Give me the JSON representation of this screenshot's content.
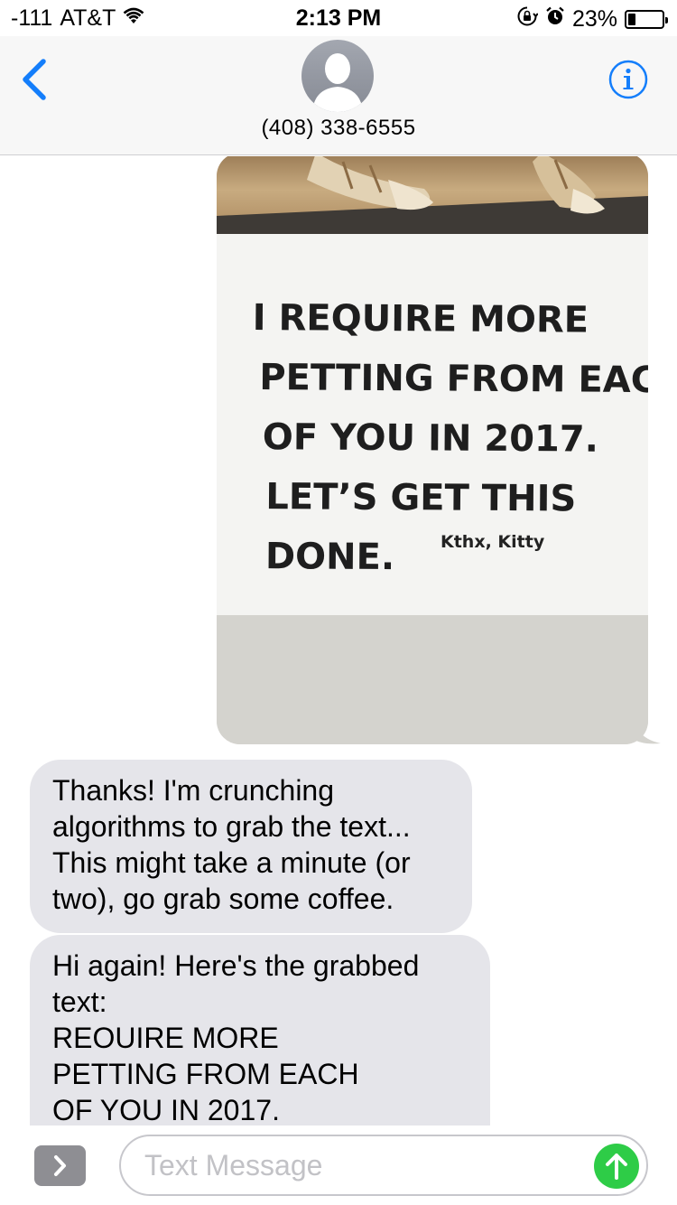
{
  "status_bar": {
    "signal": "-111",
    "carrier": "AT&T",
    "time": "2:13 PM",
    "battery": "23%",
    "battery_level": 0.23
  },
  "header": {
    "contact": "(408) 338-6555"
  },
  "conversation": {
    "photo_sign_lines": [
      "I REQUIRE MORE",
      "PETTING FROM EACH",
      "OF YOU IN 2017.",
      "LET’S GET THIS",
      "DONE."
    ],
    "photo_signature": "Kthx, Kitty",
    "message_1": "Thanks! I'm crunching algorithms to grab the text... This might take a minute (or two), go grab some coffee.",
    "message_2_lines": [
      "Hi again! Here's the grabbed",
      "text:",
      "REOUIRE MORE",
      "PETTING FROM EACH",
      "OF YOU IN 2017."
    ]
  },
  "input": {
    "placeholder": "Text Message"
  },
  "colors": {
    "accent": "#147efb",
    "incoming_bubble": "#e5e5ea",
    "send": "#2ecc47"
  },
  "icons": [
    "wifi-icon",
    "rotation-lock-icon",
    "alarm-icon",
    "battery-icon",
    "back-chevron-icon",
    "avatar-silhouette-icon",
    "info-icon",
    "apps-chevron-icon",
    "send-arrow-icon"
  ]
}
